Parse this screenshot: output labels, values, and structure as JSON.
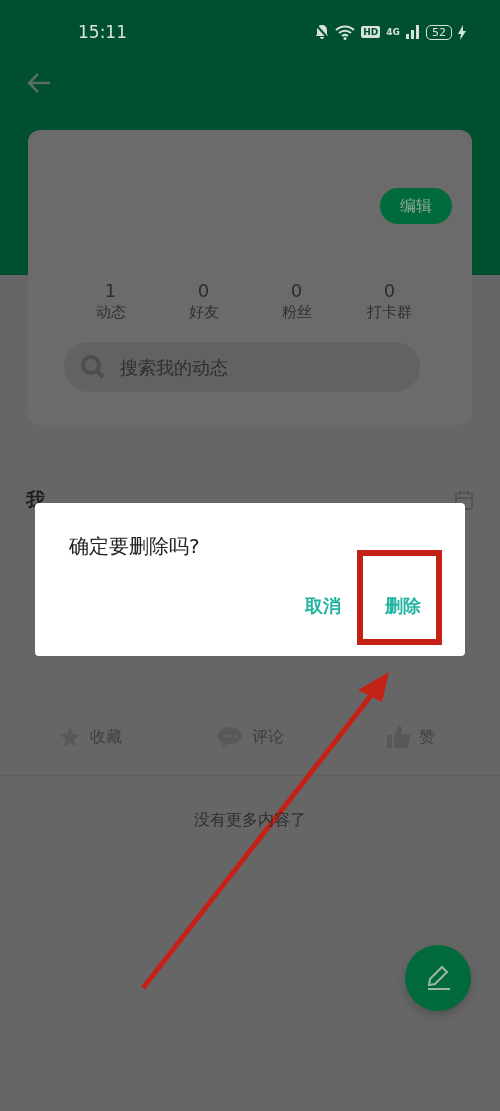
{
  "status_bar": {
    "time": "15:11",
    "hd_badge": "HD",
    "network": "4G",
    "battery": "52"
  },
  "profile": {
    "edit_button": "编辑",
    "stats": [
      {
        "value": "1",
        "label": "动态"
      },
      {
        "value": "0",
        "label": "好友"
      },
      {
        "value": "0",
        "label": "粉丝"
      },
      {
        "value": "0",
        "label": "打卡群"
      }
    ],
    "search": {
      "placeholder": "搜索我的动态"
    }
  },
  "section_title": "我",
  "post_actions": [
    {
      "kind": "star",
      "label": "收藏"
    },
    {
      "kind": "comment",
      "label": "评论"
    },
    {
      "kind": "like",
      "label": "赞"
    }
  ],
  "footer_text": "没有更多内容了",
  "dialog": {
    "message": "确定要删除吗?",
    "buttons": [
      {
        "label": "取消",
        "annotated": false
      },
      {
        "label": "删除",
        "annotated": true
      }
    ]
  }
}
